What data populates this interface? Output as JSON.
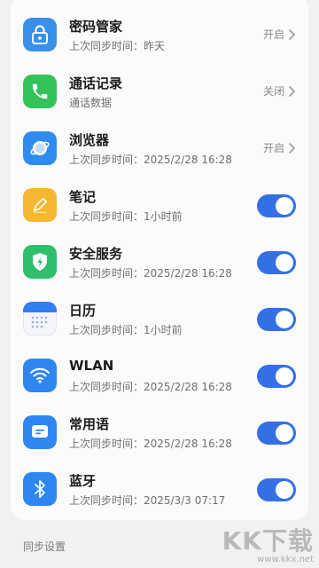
{
  "sync_items": [
    {
      "title": "密码管家",
      "subtitle": "上次同步时间：昨天",
      "control": "status",
      "status": "开启",
      "icon": "lock-icon",
      "icon_color": "#3a8fe8"
    },
    {
      "title": "通话记录",
      "subtitle": "通话数据",
      "control": "status",
      "status": "关闭",
      "icon": "phone-icon",
      "icon_color": "#34c35a"
    },
    {
      "title": "浏览器",
      "subtitle": "上次同步时间：2025/2/28 16:28",
      "control": "status",
      "status": "开启",
      "icon": "globe-icon",
      "icon_color": "#2e8cf0"
    },
    {
      "title": "笔记",
      "subtitle": "上次同步时间：1小时前",
      "control": "toggle",
      "enabled": true,
      "icon": "pencil-icon",
      "icon_color": "#f5b731"
    },
    {
      "title": "安全服务",
      "subtitle": "上次同步时间：2025/2/28 16:28",
      "control": "toggle",
      "enabled": true,
      "icon": "shield-icon",
      "icon_color": "#2dbf6a"
    },
    {
      "title": "日历",
      "subtitle": "上次同步时间：1小时前",
      "control": "toggle",
      "enabled": true,
      "icon": "calendar-icon",
      "icon_color": "#2f7ff0"
    },
    {
      "title": "WLAN",
      "subtitle": "上次同步时间：2025/2/28 16:28",
      "control": "toggle",
      "enabled": true,
      "icon": "wifi-icon",
      "icon_color": "#2e86f2"
    },
    {
      "title": "常用语",
      "subtitle": "上次同步时间：2025/2/28 16:28",
      "control": "toggle",
      "enabled": true,
      "icon": "message-icon",
      "icon_color": "#2e86f2"
    },
    {
      "title": "蓝牙",
      "subtitle": "上次同步时间：2025/3/3 07:17",
      "control": "toggle",
      "enabled": true,
      "icon": "bluetooth-icon",
      "icon_color": "#2e86f2"
    }
  ],
  "section_label": "同步设置",
  "watermark": {
    "big": "KK下载",
    "url": "www.kkx.net"
  },
  "colors": {
    "toggle_on": "#3370e6",
    "card_bg": "#fbfbfc",
    "page_bg": "#f1f1f3"
  }
}
